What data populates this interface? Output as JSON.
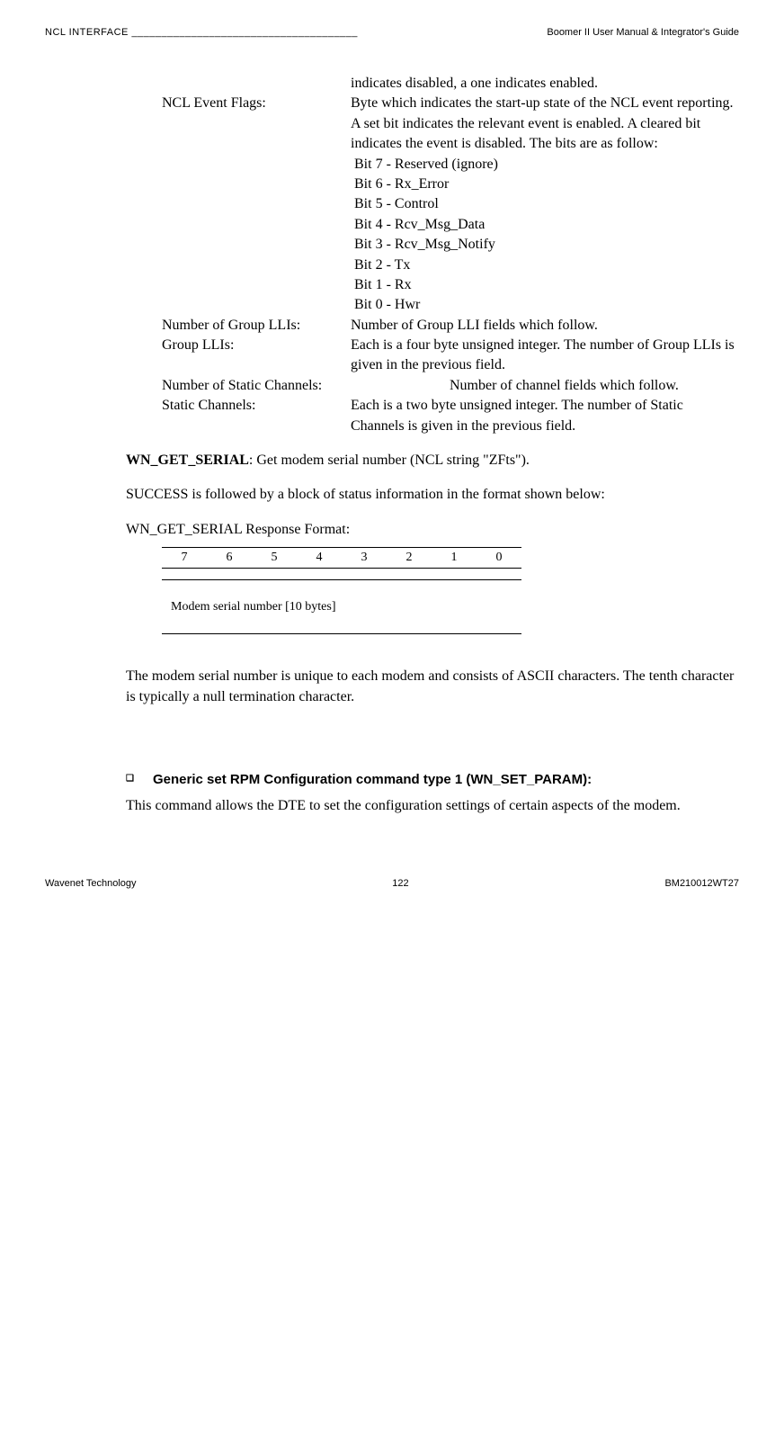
{
  "header": {
    "left": "NCL INTERFACE ______________________________________",
    "right": "Boomer II User Manual & Integrator's Guide"
  },
  "defs": {
    "pre_text": "indicates disabled, a one indicates enabled.",
    "ncl_event_flags_label": "NCL Event Flags:",
    "ncl_event_flags_desc": "Byte which indicates the start-up state of the NCL event reporting.  A set bit indicates the relevant event is enabled.  A cleared bit indicates the event is disabled.  The bits are as follow:",
    "bits": {
      "b7": " Bit 7 - Reserved (ignore)",
      "b6": " Bit 6 - Rx_Error",
      "b5": " Bit 5 - Control",
      "b4": " Bit 4 - Rcv_Msg_Data",
      "b3": " Bit 3 - Rcv_Msg_Notify",
      "b2": " Bit 2 - Tx",
      "b1": " Bit 1 - Rx",
      "b0": " Bit 0 - Hwr"
    },
    "num_group_llis_label": "Number of Group LLIs:",
    "num_group_llis_desc": "Number of Group LLI fields which follow.",
    "group_llis_label": "Group LLIs:",
    "group_llis_desc": "Each is a four byte unsigned integer.  The number of Group LLIs is given in the previous field.",
    "num_static_ch_label": "Number of Static Channels:",
    "num_static_ch_desc": "Number of channel fields which follow.",
    "static_ch_label": "Static Channels:",
    "static_ch_desc": "Each is a two byte unsigned integer.  The number of Static Channels is given in the previous field."
  },
  "wn_get_serial": {
    "label": "WN_GET_SERIAL",
    "desc": ": Get modem serial number (NCL string \"ZFts\")."
  },
  "success_text": "SUCCESS is followed by a block of status information in the format shown below:",
  "response_format_title": "WN_GET_SERIAL Response Format:",
  "bit_headers": [
    "7",
    "6",
    "5",
    "4",
    "3",
    "2",
    "1",
    "0"
  ],
  "serial_row_text": "Modem serial number [10 bytes]",
  "serial_para": "The modem serial number is unique to each modem and consists of ASCII characters.  The tenth character is typically a null termination character.",
  "section": {
    "bullet": "❑",
    "heading": "Generic set RPM Configuration command type 1 (WN_SET_PARAM):",
    "body": "This command allows the DTE to set the configuration settings of certain aspects of the modem."
  },
  "footer": {
    "left": "Wavenet Technology",
    "center": "122",
    "right": "BM210012WT27"
  }
}
